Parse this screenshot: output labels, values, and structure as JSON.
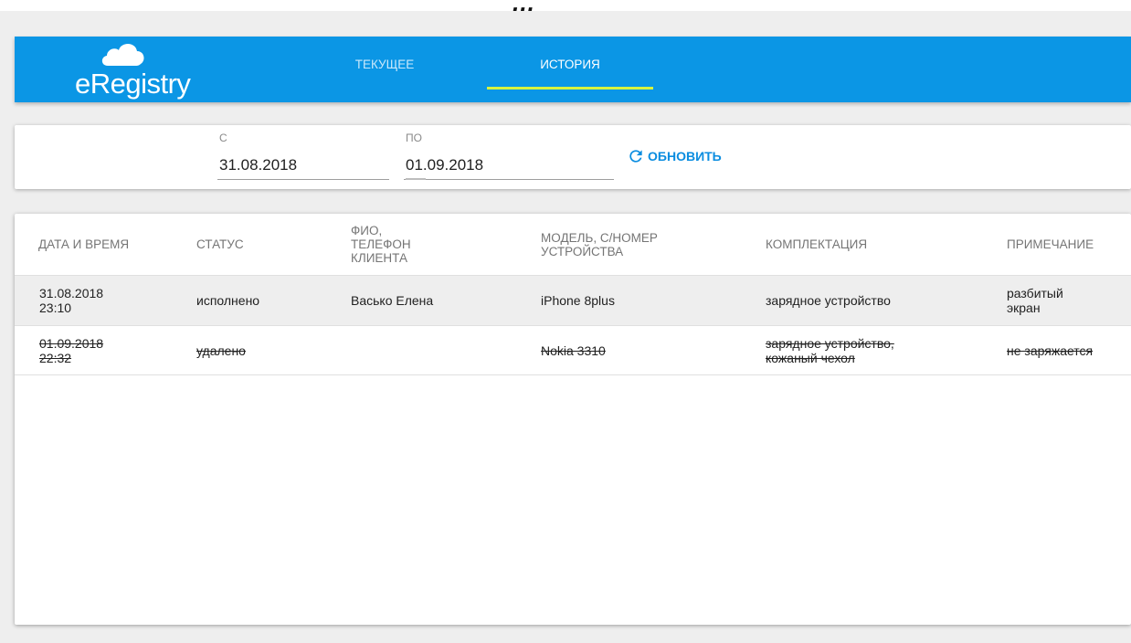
{
  "top_strip": {
    "text": "…"
  },
  "app": {
    "logo_text": "eRegistry"
  },
  "tabs": [
    {
      "label": "ТЕКУЩЕЕ",
      "active": false
    },
    {
      "label": "ИСТОРИЯ",
      "active": true
    }
  ],
  "colors": {
    "appbar": "#0b96e5",
    "tab_indicator": "#d7f33f",
    "accent": "#0b8de0",
    "selected_row": "#eeeeee"
  },
  "filters": {
    "from_label": "С",
    "from_value": "31.08.2018",
    "to_label": "ПО",
    "to_value": "01.09.2018",
    "refresh_label": "ОБНОВИТЬ",
    "refresh_icon": "refresh-icon"
  },
  "table": {
    "columns": [
      "ДАТА И ВРЕМЯ",
      "СТАТУС",
      "ФИО, ТЕЛЕФОН КЛИЕНТА",
      "МОДЕЛЬ, С/НОМЕР УСТРОЙСТВА",
      "КОМПЛЕКТАЦИЯ",
      "ПРИМЕЧАНИЕ"
    ],
    "rows": [
      {
        "datetime": "31.08.2018 23:10",
        "status": "исполнено",
        "client": "Васько Елена",
        "device": "iPhone 8plus",
        "kit": "зарядное устройство",
        "note": "разбитый экран",
        "selected": true,
        "deleted": false
      },
      {
        "datetime": "01.09.2018 22:32",
        "status": "удалено",
        "client": "",
        "device": "Nokia 3310",
        "kit": "зарядное устройство, кожаный чехол",
        "note": "не заряжается",
        "selected": false,
        "deleted": true
      }
    ]
  }
}
